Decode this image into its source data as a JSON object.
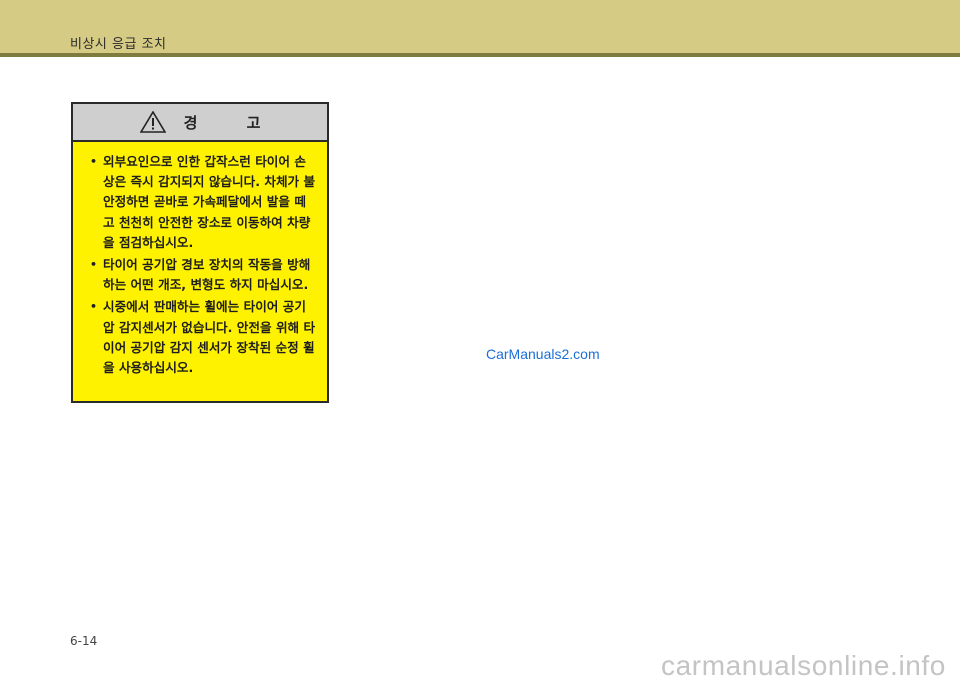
{
  "header": {
    "section_title": "비상시 응급 조치"
  },
  "warning": {
    "title": "경 고",
    "icon": "warning-triangle-icon",
    "items": [
      "외부요인으로 인한 갑작스런 타이어 손상은 즉시 감지되지 않습니다. 차체가 불안정하면 곧바로 가속페달에서 발을 떼고 천천히 안전한 장소로 이동하여 차량을 점검하십시오.",
      "타이어 공기압 경보 장치의 작동을 방해하는 어떤 개조, 변형도 하지 마십시오.",
      "시중에서 판매하는 휠에는 타이어 공기압 감지센서가 없습니다. 안전을 위해 타이어 공기압 감지 센서가 장착된 순정 휠을 사용하십시오."
    ],
    "colors": {
      "body": "#fff200",
      "header": "#cfcfcf",
      "border": "#2a2a2a"
    }
  },
  "watermark": "CarManuals2.com",
  "page_number": "6-14",
  "footer_watermark": "carmanualsonline.info"
}
